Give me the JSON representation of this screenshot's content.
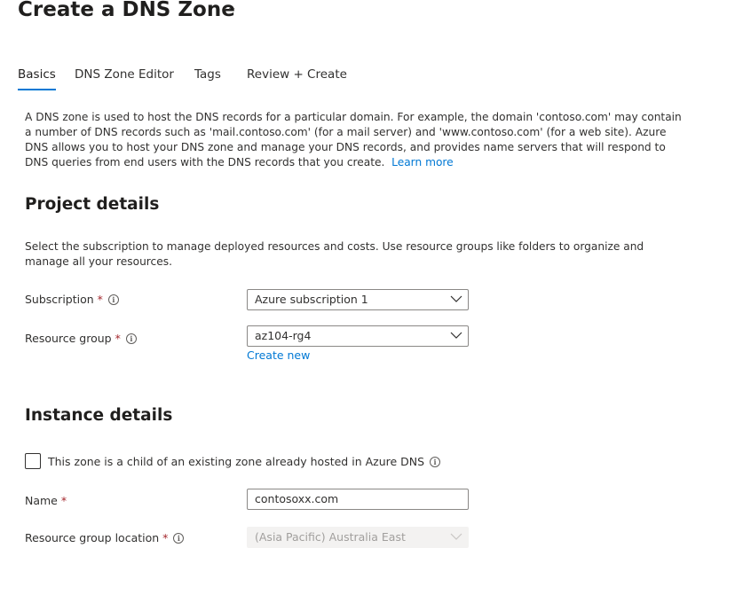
{
  "header": {
    "title": "Create a DNS Zone",
    "more_label": "···"
  },
  "tabs": [
    {
      "label": "Basics",
      "active": true
    },
    {
      "label": "DNS Zone Editor"
    },
    {
      "label": "Tags"
    },
    {
      "label": "Review + Create"
    }
  ],
  "intro": {
    "text": "A DNS zone is used to host the DNS records for a particular domain. For example, the domain 'contoso.com' may contain a number of DNS records such as 'mail.contoso.com' (for a mail server) and 'www.contoso.com' (for a web site). Azure DNS allows you to host your DNS zone and manage your DNS records, and provides name servers that will respond to DNS queries from end users with the DNS records that you create.",
    "learn_more": "Learn more"
  },
  "project": {
    "heading": "Project details",
    "description": "Select the subscription to manage deployed resources and costs. Use resource groups like folders to organize and manage all your resources.",
    "subscription_label": "Subscription",
    "subscription_value": "Azure subscription 1",
    "resource_group_label": "Resource group",
    "resource_group_value": "az104-rg4",
    "create_new": "Create new"
  },
  "instance": {
    "heading": "Instance details",
    "child_zone_label": "This zone is a child of an existing zone already hosted in Azure DNS",
    "child_zone_checked": false,
    "name_label": "Name",
    "name_value": "contosoxx.com",
    "location_label": "Resource group location",
    "location_value": "(Asia Pacific) Australia East"
  },
  "required_marker": "*",
  "info_glyph": "i",
  "colors": {
    "accent": "#0078d4",
    "required": "#a4262c",
    "disabled_bg": "#f3f2f1"
  }
}
